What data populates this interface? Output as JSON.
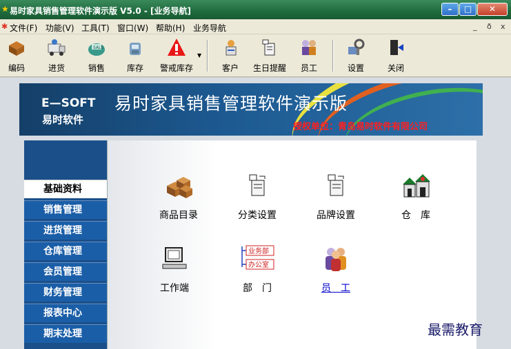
{
  "window": {
    "title": "易时家具销售管理软件演示版 V5.0 - [业务导航]",
    "controls": {
      "minimize": "–",
      "maximize": "□",
      "close": "✕"
    }
  },
  "menu": {
    "items": [
      "文件(F)",
      "功能(V)",
      "工具(T)",
      "窗口(W)",
      "帮助(H)",
      "业务导航"
    ],
    "mdi_controls": [
      "_",
      "ð",
      "x"
    ]
  },
  "toolbar": {
    "buttons": [
      {
        "label": "编码",
        "icon": "coding-icon"
      },
      {
        "label": "进货",
        "icon": "purchase-icon"
      },
      {
        "label": "销售",
        "icon": "sales-icon"
      },
      {
        "label": "库存",
        "icon": "inventory-icon"
      },
      {
        "label": "警戒库存",
        "icon": "warning-icon"
      },
      {
        "label": "客户",
        "icon": "customer-icon"
      },
      {
        "label": "生日提醒",
        "icon": "birthday-icon"
      },
      {
        "label": "员工",
        "icon": "employee-icon"
      },
      {
        "label": "设置",
        "icon": "settings-icon"
      },
      {
        "label": "关闭",
        "icon": "exit-icon"
      }
    ]
  },
  "banner": {
    "brand": "E—SOFT",
    "brand_cn": "易时软件",
    "title": "易时家具销售管理软件演示版",
    "license": "授权单位：青岛易时软件有限公司"
  },
  "sidebar": {
    "items": [
      "基础资料",
      "销售管理",
      "进货管理",
      "仓库管理",
      "会员管理",
      "财务管理",
      "报表中心",
      "期末处理"
    ],
    "active": "基础资料"
  },
  "main": {
    "items": [
      {
        "label": "商品目录",
        "icon": "boxes-icon"
      },
      {
        "label": "分类设置",
        "icon": "category-icon"
      },
      {
        "label": "品牌设置",
        "icon": "brand-icon"
      },
      {
        "label": "仓　库",
        "icon": "warehouse-icon"
      },
      {
        "label": "工作端",
        "icon": "workstation-icon"
      },
      {
        "label": "部　门",
        "icon": "department-icon",
        "tags": [
          "业务部",
          "办公室"
        ]
      },
      {
        "label": "员　工",
        "icon": "staff-icon"
      }
    ]
  },
  "watermark": "最需教育",
  "colors": {
    "title_bar": "#1f6b3e",
    "sidebar": "#1b5ea8",
    "banner": "#1d5a92",
    "license_text": "#ff2020"
  }
}
